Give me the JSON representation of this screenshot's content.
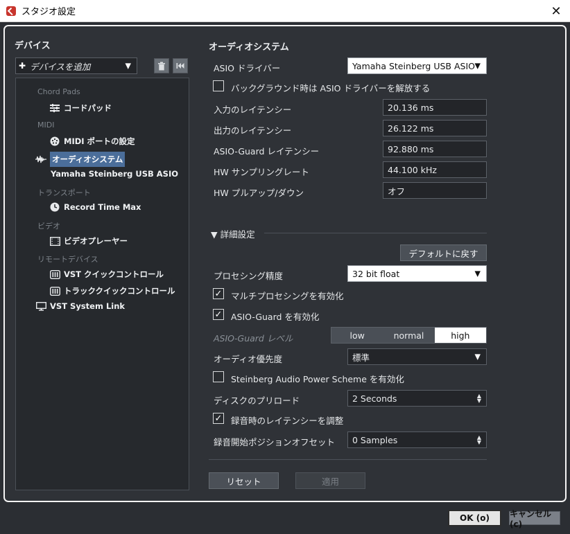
{
  "window": {
    "title": "スタジオ設定",
    "close_glyph": "✕"
  },
  "left": {
    "title": "デバイス",
    "add_device": {
      "label": "デバイスを追加",
      "plus": "✚",
      "arrow": "▼"
    },
    "trash_icon": "🗑",
    "reset_icon": "⏮",
    "tree": [
      {
        "type": "category",
        "label": "Chord Pads"
      },
      {
        "type": "item",
        "label": "コードパッド",
        "icon": "chord-pads-icon"
      },
      {
        "type": "category",
        "label": "MIDI"
      },
      {
        "type": "item",
        "label": "MIDI ポートの設定",
        "icon": "midi-port-icon"
      },
      {
        "type": "item",
        "label": "オーディオシステム",
        "icon": "audio-wave-icon",
        "selected": true
      },
      {
        "type": "item",
        "label": "Yamaha Steinberg USB ASIO",
        "icon": ""
      },
      {
        "type": "category",
        "label": "トランスポート"
      },
      {
        "type": "item",
        "label": "Record Time Max",
        "icon": "clock-icon"
      },
      {
        "type": "category",
        "label": "ビデオ"
      },
      {
        "type": "item",
        "label": "ビデオプレーヤー",
        "icon": "film-icon"
      },
      {
        "type": "category",
        "label": "リモートデバイス"
      },
      {
        "type": "item",
        "label": "VST クイックコントロール",
        "icon": "mixer-icon"
      },
      {
        "type": "item",
        "label": "トラッククイックコントロール",
        "icon": "mixer-icon"
      },
      {
        "type": "item",
        "label": "VST System Link",
        "icon": "monitor-icon"
      }
    ]
  },
  "audio_system": {
    "title": "オーディオシステム",
    "asio_driver_label": "ASIO ドライバー",
    "asio_driver_value": "Yamaha Steinberg USB ASIO",
    "release_driver_label": "バックグラウンド時は ASIO ドライバーを解放する",
    "release_driver_checked": false,
    "fields": [
      {
        "label": "入力のレイテンシー",
        "value": "20.136 ms"
      },
      {
        "label": "出力のレイテンシー",
        "value": "26.122 ms"
      },
      {
        "label": "ASIO-Guard レイテンシー",
        "value": "92.880 ms"
      },
      {
        "label": "HW サンプリングレート",
        "value": "44.100 kHz"
      },
      {
        "label": "HW プルアップ/ダウン",
        "value": "オフ"
      }
    ]
  },
  "advanced": {
    "title": "▼  詳細設定",
    "default_button": "デフォルトに戻す",
    "processing_precision_label": "プロセシング精度",
    "processing_precision_value": "32 bit float",
    "multiprocessing_label": "マルチプロセシングを有効化",
    "multiprocessing_checked": true,
    "asio_guard_label": "ASIO-Guard を有効化",
    "asio_guard_checked": true,
    "asio_guard_level_label": "ASIO-Guard レベル",
    "asio_guard_levels": [
      "low",
      "normal",
      "high"
    ],
    "asio_guard_level_selected": "high",
    "audio_priority_label": "オーディオ優先度",
    "audio_priority_value": "標準",
    "power_scheme_label": "Steinberg Audio Power Scheme を有効化",
    "power_scheme_checked": false,
    "disk_preload_label": "ディスクのプリロード",
    "disk_preload_value": "2 Seconds",
    "adjust_latency_label": "録音時のレイテンシーを調整",
    "adjust_latency_checked": true,
    "record_offset_label": "録音開始ポジションオフセット",
    "record_offset_value": "0 Samples"
  },
  "panel_buttons": {
    "reset": "リセット",
    "apply": "適用"
  },
  "footer": {
    "ok": "OK (o)",
    "cancel": "キャンセル (c)"
  },
  "glyphs": {
    "check": "✓",
    "dropdown_arrow": "▼",
    "spin_up": "▲",
    "spin_down": "▼"
  }
}
